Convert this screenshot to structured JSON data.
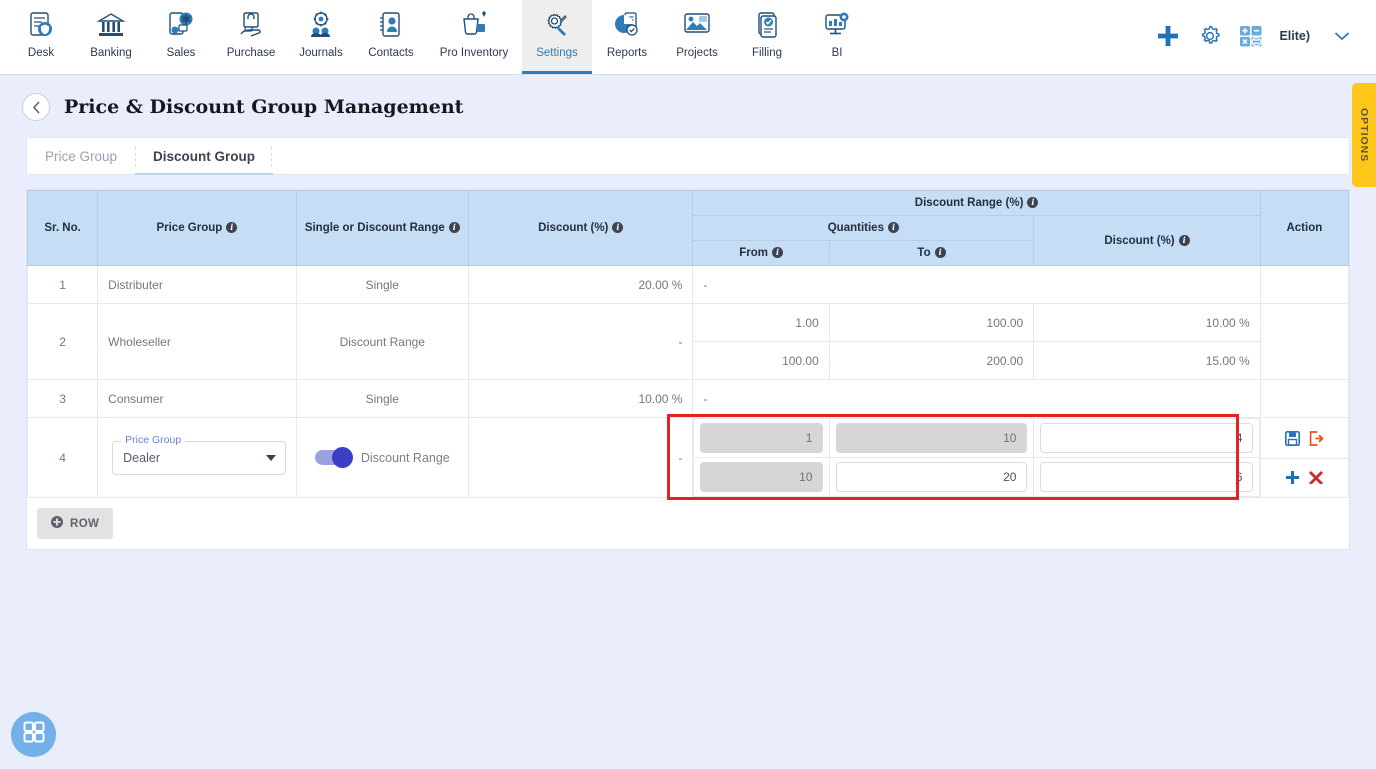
{
  "topnav": {
    "items": [
      {
        "label": "Desk",
        "icon": "desk-icon",
        "active": false
      },
      {
        "label": "Banking",
        "icon": "bank-icon",
        "active": false
      },
      {
        "label": "Sales",
        "icon": "sales-icon",
        "active": false
      },
      {
        "label": "Purchase",
        "icon": "purchase-icon",
        "active": false
      },
      {
        "label": "Journals",
        "icon": "journals-icon",
        "active": false
      },
      {
        "label": "Contacts",
        "icon": "contacts-icon",
        "active": false
      },
      {
        "label": "Pro Inventory",
        "icon": "inventory-icon",
        "active": false
      },
      {
        "label": "Settings",
        "icon": "settings-icon",
        "active": true
      },
      {
        "label": "Reports",
        "icon": "reports-icon",
        "active": false
      },
      {
        "label": "Projects",
        "icon": "projects-icon",
        "active": false
      },
      {
        "label": "Filling",
        "icon": "filling-icon",
        "active": false
      },
      {
        "label": "BI",
        "icon": "bi-icon",
        "active": false
      }
    ],
    "right": {
      "add_icon": "plus-icon",
      "settings_icon": "gear-icon",
      "calculator_icon": "calculator-icon",
      "user_label": "Elite)",
      "chevron": "chevron-down-icon"
    }
  },
  "page": {
    "back_icon": "chevron-left-icon",
    "title": "Price & Discount Group Management"
  },
  "tabs": [
    {
      "label": "Price Group",
      "active": false
    },
    {
      "label": "Discount Group",
      "active": true
    }
  ],
  "table": {
    "headers": {
      "sr_no": "Sr. No.",
      "price_group": "Price Group",
      "single_or_range": "Single or Discount Range",
      "discount": "Discount (%)",
      "discount_range": "Discount Range (%)",
      "quantities": "Quantities",
      "from": "From",
      "to": "To",
      "range_discount": "Discount (%)",
      "action": "Action"
    },
    "rows": [
      {
        "sr_no": "1",
        "price_group": "Distributer",
        "mode": "Single",
        "discount": "20.00 %",
        "ranges": [
          {
            "from": "-",
            "to": "",
            "discount": ""
          }
        ]
      },
      {
        "sr_no": "2",
        "price_group": "Wholeseller",
        "mode": "Discount Range",
        "discount": "-",
        "ranges": [
          {
            "from": "1.00",
            "to": "100.00",
            "discount": "10.00 %"
          },
          {
            "from": "100.00",
            "to": "200.00",
            "discount": "15.00 %"
          }
        ]
      },
      {
        "sr_no": "3",
        "price_group": "Consumer",
        "mode": "Single",
        "discount": "10.00 %",
        "ranges": [
          {
            "from": "-",
            "to": "",
            "discount": ""
          }
        ]
      }
    ],
    "edit_row": {
      "sr_no": "4",
      "price_group_label": "Price Group",
      "price_group_value": "Dealer",
      "toggle_label": "Discount Range",
      "toggle_on": true,
      "discount": "-",
      "inputs": [
        {
          "from": "1",
          "from_disabled": true,
          "to": "10",
          "to_disabled": true,
          "discount": "4",
          "discount_disabled": false
        },
        {
          "from": "10",
          "from_disabled": true,
          "to": "20",
          "to_disabled": false,
          "discount": "6",
          "discount_disabled": false
        }
      ],
      "actions": {
        "save_icon": "save-floppy-icon",
        "exit_icon": "exit-arrow-icon",
        "add_icon": "plus-icon",
        "delete_icon": "close-x-icon"
      }
    },
    "add_row_button": {
      "label": "ROW",
      "icon": "plus-circle-icon"
    }
  },
  "options_tab": {
    "label": "OPTIONS"
  },
  "fab": {
    "icon": "grid-apps-icon"
  },
  "colors": {
    "accent_blue": "#2e7cb8",
    "header_blue": "#c5ddf5",
    "page_bg": "#e9edfc",
    "highlight_red": "#e02424",
    "options_yellow": "#ffc719",
    "toggle_on": "#3a3fc4",
    "save_blue": "#2d72b8",
    "exit_orange": "#e8521f",
    "delete_red": "#cc2b2b"
  }
}
